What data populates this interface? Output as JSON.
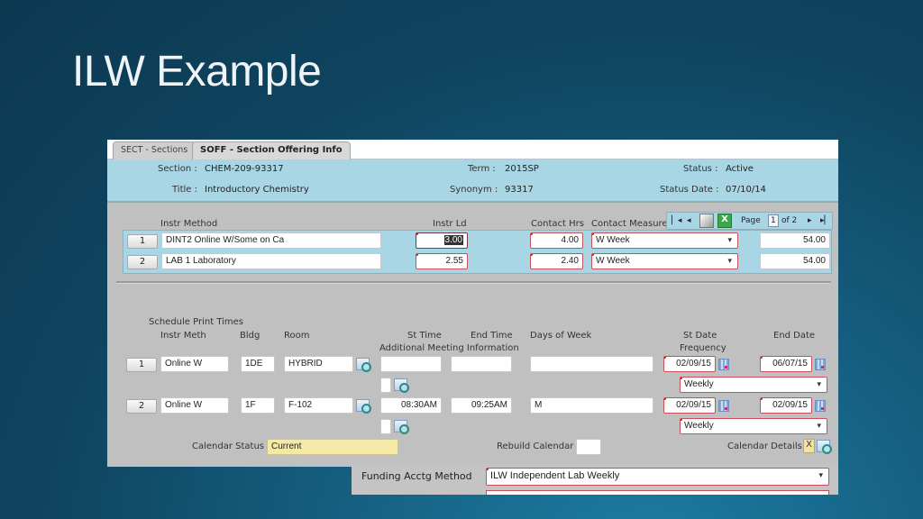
{
  "slide": {
    "title": "ILW Example"
  },
  "tabs": [
    {
      "label": "SECT - Sections",
      "active": false
    },
    {
      "label": "SOFF - Section Offering Info",
      "active": true
    }
  ],
  "header": {
    "section_label": "Section :",
    "section_value": "CHEM-209-93317",
    "title_label": "Title :",
    "title_value": "Introductory Chemistry",
    "term_label": "Term :",
    "term_value": "2015SP",
    "synonym_label": "Synonym :",
    "synonym_value": "93317",
    "status_label": "Status :",
    "status_value": "Active",
    "status_date_label": "Status Date :",
    "status_date_value": "07/10/14"
  },
  "instr": {
    "headers": {
      "method": "Instr Method",
      "load": "Instr Ld",
      "contact_hrs": "Contact Hrs",
      "contact_measure": "Contact Measure"
    },
    "rows": [
      {
        "num": "1",
        "method": "DINT2 Online W/Some on Ca",
        "load": "3.00",
        "contact_hrs": "4.00",
        "measure": "W Week",
        "total": "54.00"
      },
      {
        "num": "2",
        "method": "LAB 1 Laboratory",
        "load": "2.55",
        "contact_hrs": "2.40",
        "measure": "W Week",
        "total": "54.00"
      }
    ],
    "pager": {
      "page_label": "Page",
      "page": "1",
      "of_label": "of 2"
    }
  },
  "schedule": {
    "headers": {
      "print_times": "Schedule Print Times",
      "instr_meth": "Instr Meth",
      "bldg": "Bldg",
      "room": "Room",
      "st_time": "St Time",
      "end_time": "End Time",
      "additional": "Additional Meeting Information",
      "days": "Days of Week",
      "st_date": "St Date",
      "frequency": "Frequency",
      "end_date": "End Date"
    },
    "rows": [
      {
        "num": "1",
        "meth": "Online W",
        "bldg": "1DE",
        "room": "HYBRID",
        "st_time": "",
        "end_time": "",
        "days": "",
        "st_date": "02/09/15",
        "end_date": "06/07/15",
        "frequency": "Weekly"
      },
      {
        "num": "2",
        "meth": "Online W",
        "bldg": "1F",
        "room": "F-102",
        "st_time": "08:30AM",
        "end_time": "09:25AM",
        "days": "M",
        "st_date": "02/09/15",
        "end_date": "02/09/15",
        "frequency": "Weekly"
      }
    ]
  },
  "footer": {
    "calendar_status_label": "Calendar Status",
    "calendar_status_value": "Current",
    "rebuild_label": "Rebuild Calendar",
    "rebuild_value": "",
    "details_label": "Calendar Details",
    "details_value": "X"
  },
  "funding": {
    "label": "Funding Acctg Method",
    "value": "ILW   Independent Lab Weekly"
  }
}
